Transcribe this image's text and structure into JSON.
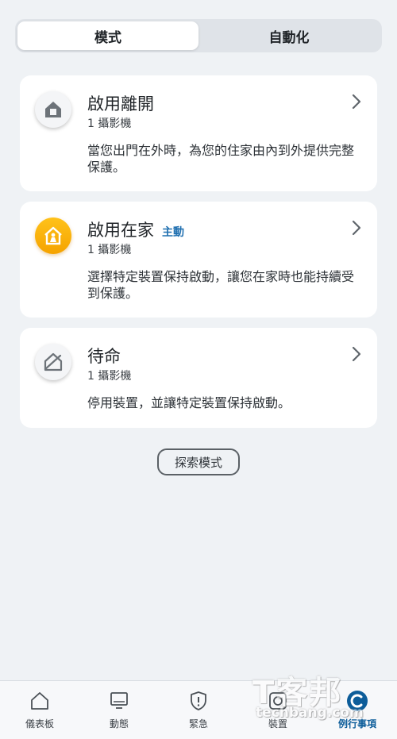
{
  "segmented": {
    "tabs": [
      {
        "label": "模式",
        "active": true
      },
      {
        "label": "自動化",
        "active": false
      }
    ]
  },
  "modes": [
    {
      "title": "啟用離開",
      "badge": "",
      "cameras": "1 攝影機",
      "description": "當您出門在外時，為您的住家由內到外提供完整保護。",
      "icon": "home-away-icon"
    },
    {
      "title": "啟用在家",
      "badge": "主動",
      "cameras": "1 攝影機",
      "description": "選擇特定裝置保持啟動，讓您在家時也能持續受到保護。",
      "icon": "home-stay-icon"
    },
    {
      "title": "待命",
      "badge": "",
      "cameras": "1 攝影機",
      "description": "停用裝置，並讓特定裝置保持啟動。",
      "icon": "standby-icon"
    }
  ],
  "explore_button": "探索模式",
  "bottom_nav": [
    {
      "label": "儀表板",
      "icon": "home-icon",
      "active": false
    },
    {
      "label": "動態",
      "icon": "monitor-icon",
      "active": false
    },
    {
      "label": "緊急",
      "icon": "shield-alert-icon",
      "active": false
    },
    {
      "label": "裝置",
      "icon": "camera-device-icon",
      "active": false
    },
    {
      "label": "例行事項",
      "icon": "routine-icon",
      "active": true
    }
  ],
  "watermark": {
    "brand": "T客邦",
    "site": "techbang.com"
  },
  "colors": {
    "background": "#eff2f5",
    "accent": "#1f6fb0",
    "active_mode": "#f5a300",
    "active_tab": "#0d5d9a"
  }
}
